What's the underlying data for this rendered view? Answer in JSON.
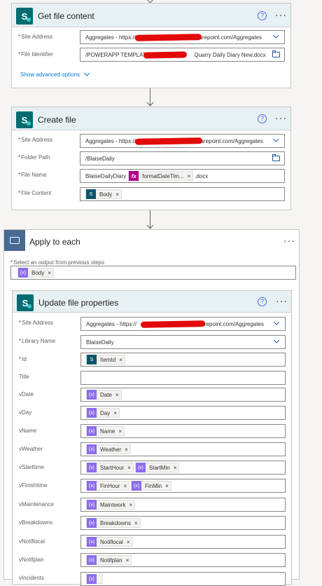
{
  "get_file_content": {
    "title": "Get file content",
    "site_address_label": "Site Address",
    "site_address_prefix": "Aggregates - https://",
    "site_address_suffix": "harepoint.com/Aggregates",
    "file_identifier_label": "File Identifier",
    "file_identifier_prefix": "/POWERAPP TEMPLATES",
    "file_identifier_suffix": "Quarry Daily Diary New.docx",
    "advanced_link": "Show advanced options"
  },
  "create_file": {
    "title": "Create file",
    "site_address_label": "Site Address",
    "site_address_prefix": "Aggregates - https://",
    "site_address_suffix": "sharepoint.com/Aggregates",
    "folder_path_label": "Folder Path",
    "folder_path_value": "/BlaiseDaily",
    "file_name_label": "File Name",
    "file_name_prefix": "BlaiseDailyDiary",
    "file_name_token": "formatDateTim...",
    "file_name_suffix": ".docx",
    "file_content_label": "File Content",
    "file_content_token": "Body"
  },
  "apply_to_each": {
    "title": "Apply to each",
    "select_label": "Select an output from previous steps",
    "select_token": "Body"
  },
  "update_file_properties": {
    "title": "Update file properties",
    "site_address_label": "Site Address",
    "site_address_prefix": "Aggregates - https://",
    "site_address_suffix": "harepoint.com/Aggregates",
    "library_name_label": "Library Name",
    "library_name_value": "BlaiseDaily",
    "id_label": "Id",
    "id_token": "ItemId",
    "title_label": "Title",
    "vdate_label": "vDate",
    "vdate_token": "Date",
    "vday_label": "vDay",
    "vday_token": "Day",
    "vname_label": "vName",
    "vname_token": "Name",
    "vweather_label": "vWeather",
    "vweather_token": "Weather",
    "vstarttime_label": "vStarttime",
    "vstarttime_token1": "StartHour",
    "vstarttime_token2": "StartMin",
    "vfinishtime_label": "vFinishtime",
    "vfinishtime_token1": "FinHour",
    "vfinishtime_token2": "FinMin",
    "vmaintenance_label": "vMaintenance",
    "vmaintenance_token": "Maintwork",
    "vbreakdowns_label": "vBreakdowns",
    "vbreakdowns_token": "Breakdowns",
    "vnotiflocal_label": "vNotiflocal",
    "vnotiflocal_token": "Notiflocal",
    "vnotifplan_label": "vNotifplan",
    "vnotifplan_token": "Notifplan",
    "vincidents_label": "vIncidents"
  },
  "glyphs": {
    "sp_letter": "S",
    "help": "?",
    "more": "···",
    "close": "×",
    "fx": "fx",
    "var": "{x}",
    "token_sp": "S",
    "required": "*"
  },
  "colors": {
    "sharepoint": "#036c70",
    "variable": "#8c6cec",
    "expression": "#ad008c",
    "loop_header": "#486991",
    "link": "#0078d4",
    "redaction": "#e30a0a"
  }
}
